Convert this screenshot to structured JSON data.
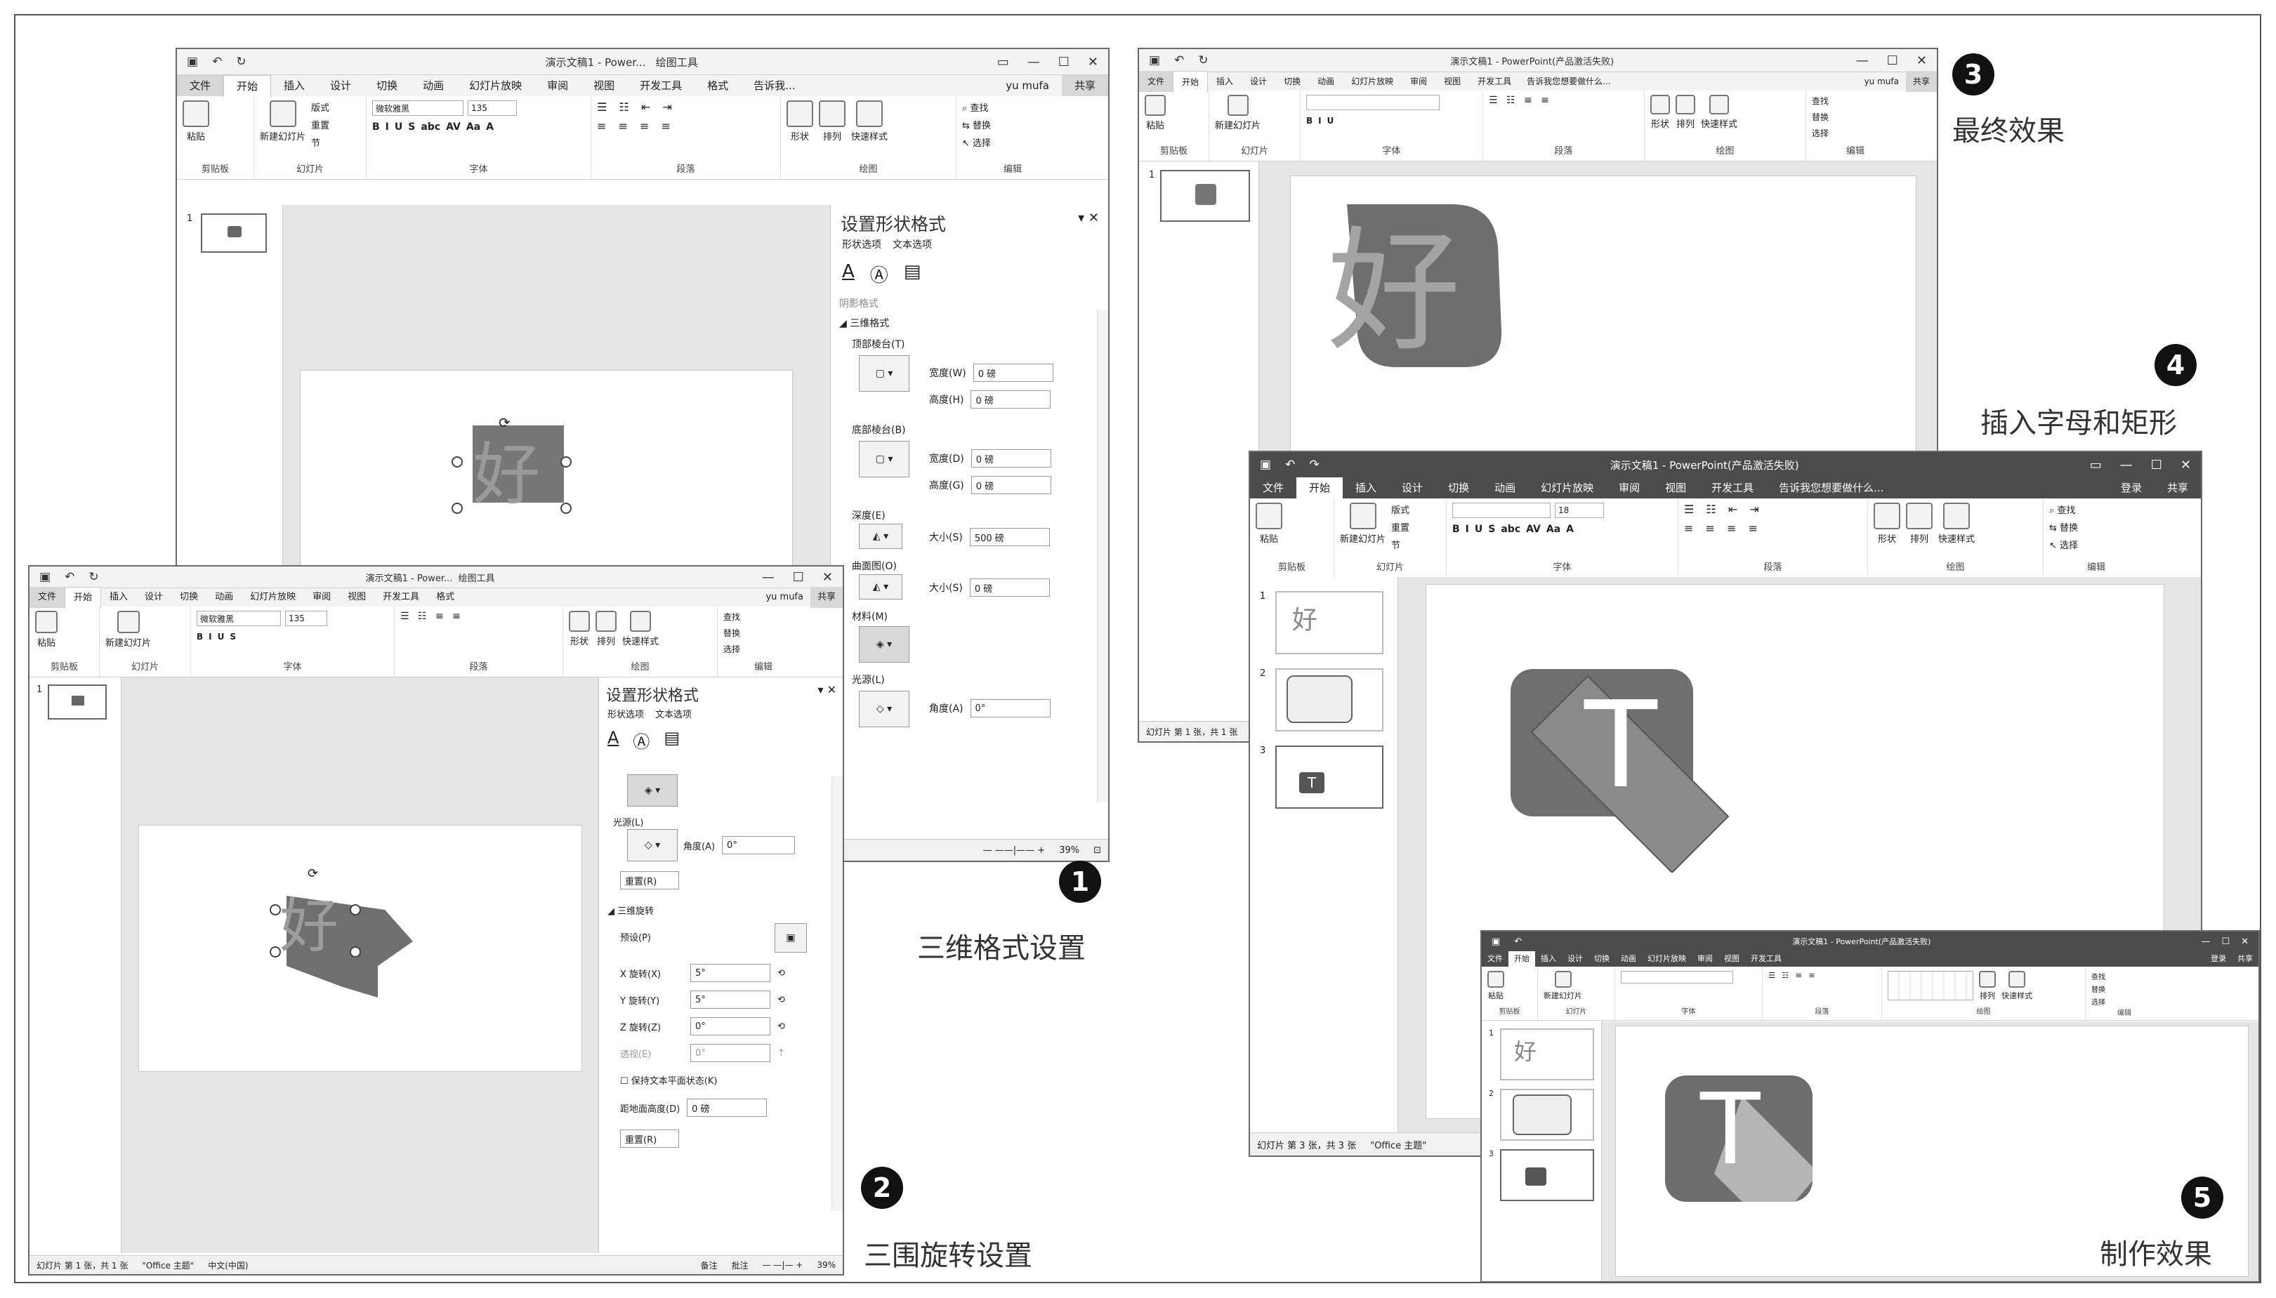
{
  "app": {
    "title_full": "演示文稿1 - PowerPoint(产品激活失败)",
    "title_short": "演示文稿1 - Power...",
    "context_tool": "绘图工具",
    "user": "yu mufa",
    "share": "共享",
    "search_hint": "告诉我您想要做什么...",
    "search_short": "告诉我...",
    "signin": "登录"
  },
  "tabs": [
    "文件",
    "开始",
    "插入",
    "设计",
    "切换",
    "动画",
    "幻灯片放映",
    "审阅",
    "视图",
    "开发工具",
    "格式"
  ],
  "ribbon": {
    "clipboard": {
      "paste": "粘贴",
      "label": "剪贴板"
    },
    "slides": {
      "new_slide": "新建幻灯片",
      "layout": "版式",
      "reset": "重置",
      "section": "节",
      "label": "幻灯片"
    },
    "font": {
      "font_name": "微软雅黑",
      "font_size": "135",
      "font_size_small": "18",
      "label": "字体",
      "bold": "B",
      "italic": "I",
      "underline": "U",
      "shadow": "S",
      "strike": "abc",
      "spacing": "AV",
      "case": "Aa",
      "color": "A"
    },
    "paragraph": {
      "label": "段落"
    },
    "drawing": {
      "shapes": "形状",
      "arrange": "排列",
      "quick_styles": "快速样式",
      "label": "绘图"
    },
    "editing": {
      "find": "查找",
      "replace": "替换",
      "select": "选择",
      "label": "编辑"
    }
  },
  "pane": {
    "title": "设置形状格式",
    "tab_shape": "形状选项",
    "tab_text": "文本选项",
    "section_shadow": "阴影格式",
    "section_3d_format": "三维格式",
    "top_bevel": "顶部棱台(T)",
    "bottom_bevel": "底部棱台(B)",
    "width_w": "宽度(W)",
    "height_h": "高度(H)",
    "width_d": "宽度(D)",
    "height_g": "高度(G)",
    "depth": "深度(E)",
    "contour": "曲面图(O)",
    "size_s": "大小(S)",
    "size_i": "大小(S)",
    "material": "材料(M)",
    "lighting": "光源(L)",
    "angle": "角度(A)",
    "val_0": "0 磅",
    "val_500": "500 磅",
    "val_angle": "0°",
    "reset": "重置(R)",
    "section_3d_rotation": "三维旋转",
    "preset": "预设(P)",
    "x_rotation": "X 旋转(X)",
    "y_rotation": "Y 旋转(Y)",
    "z_rotation": "Z 旋转(Z)",
    "perspective": "透视(E)",
    "x_val": "5°",
    "y_val": "5°",
    "z_val": "0°",
    "p_val": "0°",
    "keep_text_flat": "保持文本平面状态(K)",
    "distance_ground": "距地面高度(D)",
    "distance_val": "0 磅"
  },
  "status": {
    "slide_1_of_1": "幻灯片 第 1 张，共 1 张",
    "slide_3_of_3": "幻灯片 第 3 张，共 3 张",
    "theme": "\"Office 主题\"",
    "lang": "中文(中国)",
    "notes": "备注",
    "comments": "批注",
    "zoom": "39%"
  },
  "slide_content": {
    "char_hao": "好",
    "char_t": "T"
  },
  "thumb_nums": [
    "1",
    "2",
    "3"
  ],
  "captions": {
    "s1": "三维格式设置",
    "s2": "三围旋转设置",
    "s3": "最终效果",
    "s4": "插入字母和矩形",
    "s5": "制作效果"
  },
  "steps": [
    "1",
    "2",
    "3",
    "4",
    "5"
  ]
}
